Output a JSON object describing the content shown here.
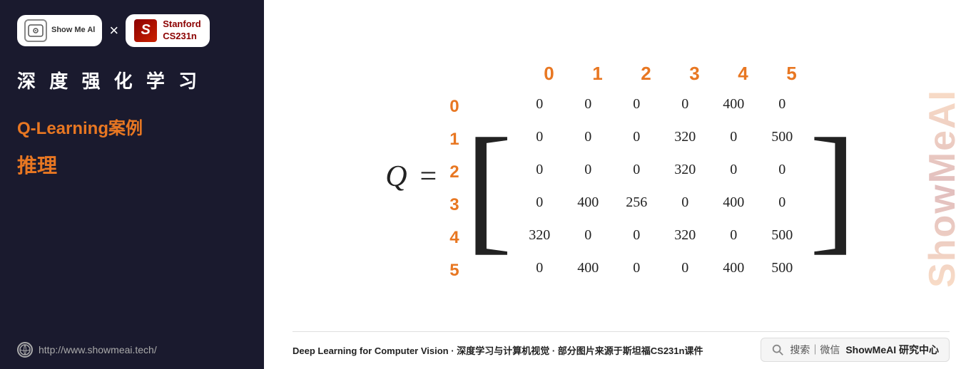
{
  "sidebar": {
    "logo": {
      "showmeai_label": "Show Me Al",
      "times": "×",
      "stanford_line1": "Stanford",
      "stanford_line2": "CS231n"
    },
    "title": "深 度 强 化 学 习",
    "subtitle": "Q-Learning案例",
    "section": "推理",
    "url": "http://www.showmeai.tech/"
  },
  "matrix": {
    "q_label": "Q",
    "equals": "=",
    "col_headers": [
      "0",
      "1",
      "2",
      "3",
      "4",
      "5"
    ],
    "row_headers": [
      "0",
      "1",
      "2",
      "3",
      "4",
      "5"
    ],
    "rows": [
      [
        "0",
        "0",
        "0",
        "0",
        "400",
        "0"
      ],
      [
        "0",
        "0",
        "0",
        "320",
        "0",
        "500"
      ],
      [
        "0",
        "0",
        "0",
        "320",
        "0",
        "0"
      ],
      [
        "0",
        "400",
        "256",
        "0",
        "400",
        "0"
      ],
      [
        "320",
        "0",
        "0",
        "320",
        "0",
        "500"
      ],
      [
        "0",
        "400",
        "0",
        "0",
        "400",
        "500"
      ]
    ]
  },
  "watermark": {
    "text": "ShowMeAI"
  },
  "footer": {
    "left_plain": "Deep Learning for Computer Vision · ",
    "left_bold": "深度学习与计算机视觉",
    "left_suffix": " · 部分图片来源于斯坦福CS231n课件",
    "search_prefix": "搜索｜微信 ",
    "search_brand": "ShowMeAI 研究中心"
  }
}
